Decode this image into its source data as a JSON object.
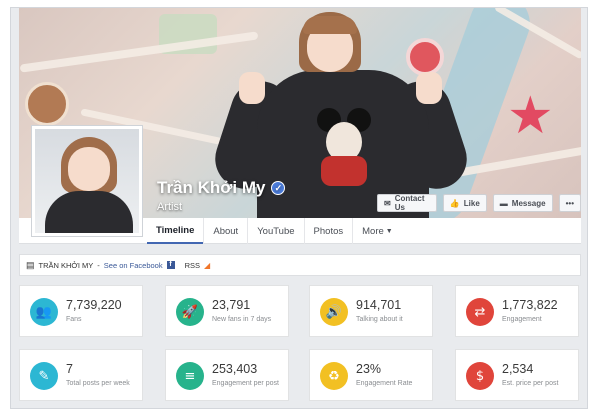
{
  "page": {
    "name": "Trần Khởi My",
    "category": "Artist",
    "verified_icon": "verified-check-icon"
  },
  "actions": [
    {
      "label": "Contact Us",
      "icon": "envelope-icon"
    },
    {
      "label": "Like",
      "icon": "thumbs-up-icon"
    },
    {
      "label": "Message",
      "icon": "chat-bubble-icon"
    },
    {
      "label": "•••",
      "icon": "more-icon"
    }
  ],
  "tabs": [
    "Timeline",
    "About",
    "YouTube",
    "Photos",
    "More"
  ],
  "strip": {
    "page_label": "TRẦN KHỞI MY",
    "separator": " - ",
    "link_label": "See on Facebook",
    "rss_label": "RSS"
  },
  "stats": [
    {
      "value": "7,739,220",
      "label": "Fans",
      "color": "#2cb7d3",
      "icon": "group-icon"
    },
    {
      "value": "23,791",
      "label": "New fans in 7 days",
      "color": "#27b38c",
      "icon": "rocket-icon"
    },
    {
      "value": "914,701",
      "label": "Talking about it",
      "color": "#f2c023",
      "icon": "megaphone-icon"
    },
    {
      "value": "1,773,822",
      "label": "Engagement",
      "color": "#e0453b",
      "icon": "exchange-icon"
    },
    {
      "value": "7",
      "label": "Total posts per week",
      "color": "#2cb7d3",
      "icon": "edit-icon"
    },
    {
      "value": "253,403",
      "label": "Engagement per post",
      "color": "#27b38c",
      "icon": "sliders-icon"
    },
    {
      "value": "23%",
      "label": "Engagement Rate",
      "color": "#f2c023",
      "icon": "recycle-icon"
    },
    {
      "value": "2,534",
      "label": "Est. price per post",
      "color": "#e0453b",
      "icon": "dollar-icon"
    }
  ]
}
